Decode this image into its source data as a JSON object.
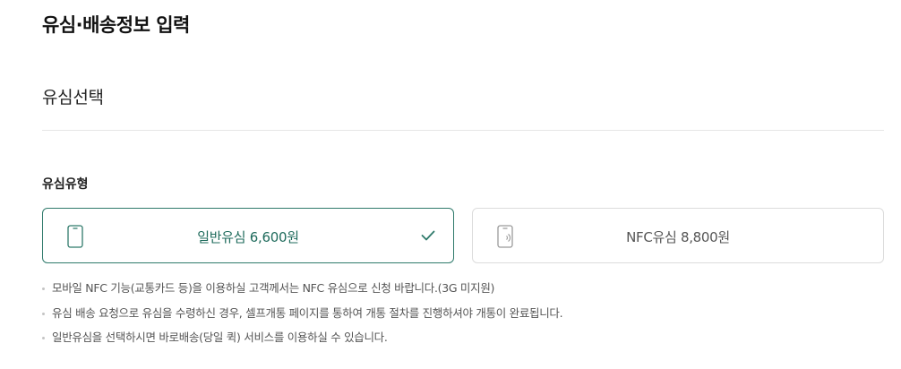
{
  "page": {
    "title": "유심·배송정보 입력"
  },
  "section": {
    "title": "유심선택",
    "usim_type_label": "유심유형"
  },
  "options": [
    {
      "label": "일반유심 6,600원",
      "selected": true,
      "icon": "phone-icon"
    },
    {
      "label": "NFC유심 8,800원",
      "selected": false,
      "icon": "nfc-phone-icon"
    }
  ],
  "notes": [
    "모바일 NFC 기능(교통카드 등)을 이용하실 고객께서는 NFC 유심으로 신청 바랍니다.(3G 미지원)",
    "유심 배송 요청으로 유심을 수령하신 경우, 셀프개통 페이지를 통하여 개통 절차를 진행하셔야 개통이 완료됩니다.",
    "일반유심을 선택하시면 바로배송(당일 퀵) 서비스를 이용하실 수 있습니다."
  ],
  "colors": {
    "accent": "#2f7a6b",
    "border": "#dcdcdc",
    "note_text": "#555555"
  }
}
